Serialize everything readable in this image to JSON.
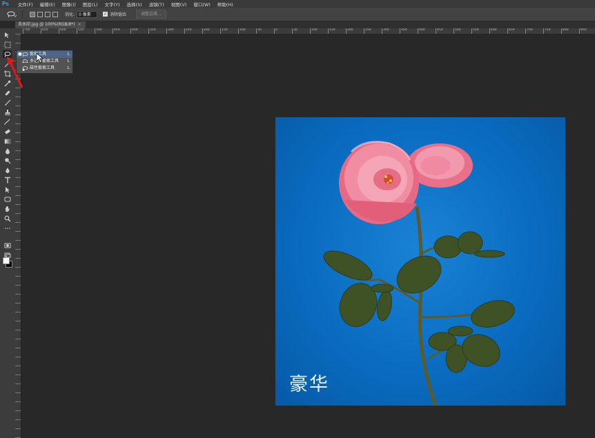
{
  "app": {
    "logo": "Ps"
  },
  "menu": [
    "文件(F)",
    "编辑(E)",
    "图像(I)",
    "图层(L)",
    "文字(Y)",
    "选择(S)",
    "滤镜(T)",
    "视图(V)",
    "窗口(W)",
    "帮助(H)"
  ],
  "options": {
    "feather_label": "羽化:",
    "feather_value": "0 像素",
    "antialias_label": "消除锯齿",
    "antialias_checked": true,
    "refine_edge_label": "调整边缘..."
  },
  "document_tab": {
    "title": "去水印.jpg @ 100%(RGB/8*)",
    "close": "×"
  },
  "ruler_labels": [
    "700",
    "650",
    "600",
    "550",
    "500",
    "450",
    "400",
    "350",
    "300",
    "250",
    "200",
    "150",
    "100",
    "50",
    "0",
    "50",
    "100",
    "150",
    "200",
    "250",
    "300",
    "350",
    "400",
    "450",
    "500",
    "550",
    "600",
    "650",
    "700",
    "750",
    "800",
    "850",
    "900",
    "950",
    "1000",
    "1050",
    "1100",
    "1150",
    "1200",
    "1250",
    "1300"
  ],
  "flyout": {
    "items": [
      {
        "label": "套索工具",
        "shortcut": "L",
        "selected": true,
        "icon": "lasso-icon"
      },
      {
        "label": "多边形套索工具",
        "shortcut": "L",
        "selected": false,
        "icon": "polygonal-lasso-icon"
      },
      {
        "label": "磁性套索工具",
        "shortcut": "L",
        "selected": false,
        "icon": "magnetic-lasso-icon"
      }
    ]
  },
  "image": {
    "watermark_text": "豪华"
  },
  "colors": {
    "foreground": "#ffffff",
    "background": "#000000",
    "canvas_bg": "#0a6cc0",
    "flyout_selected": "#4d6687",
    "annotation_arrow": "#e0191e"
  }
}
